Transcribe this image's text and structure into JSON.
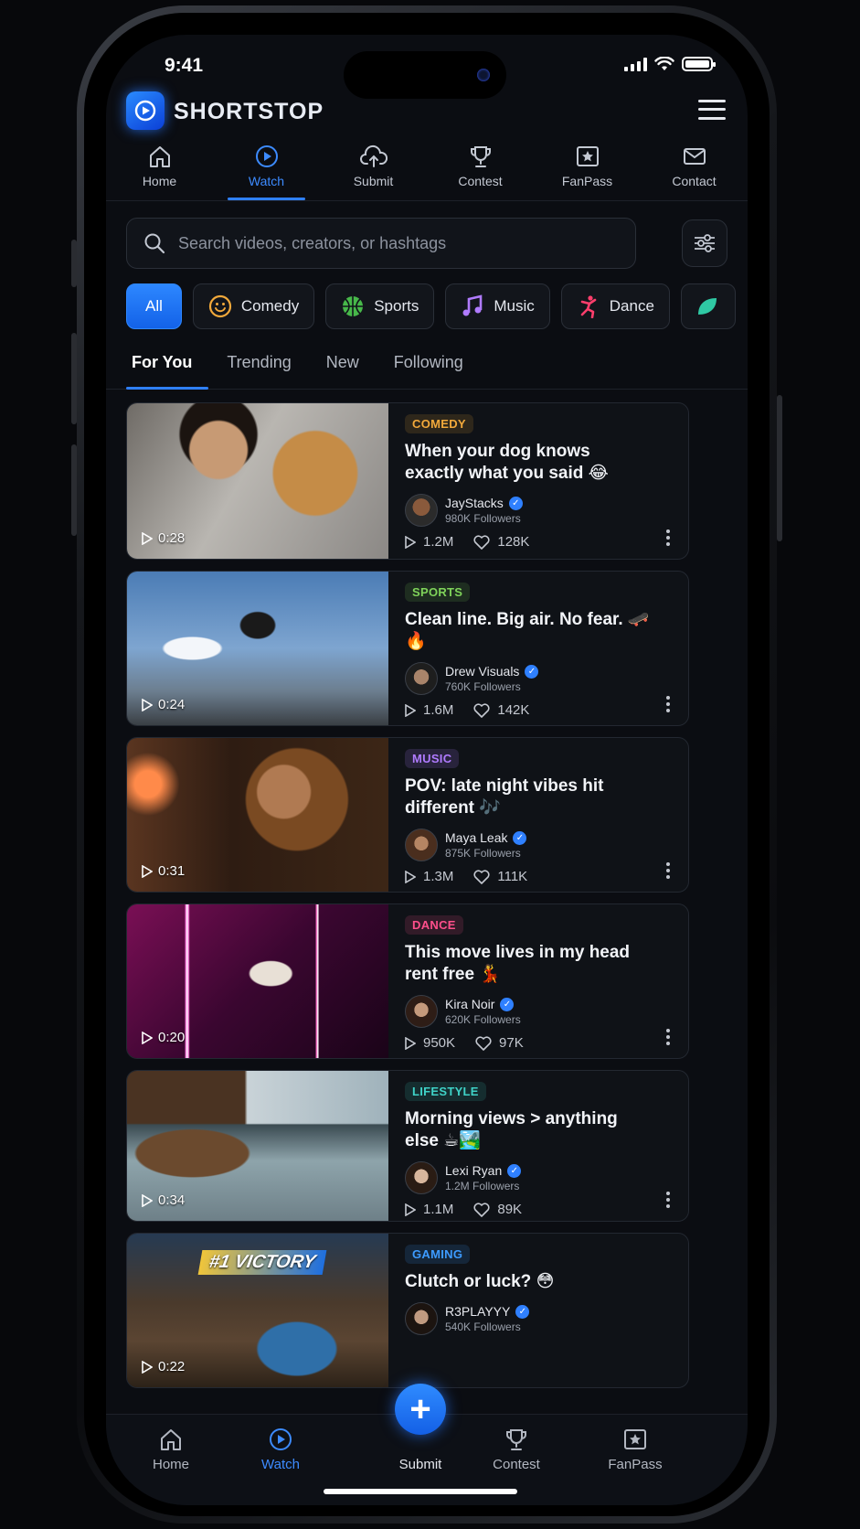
{
  "status": {
    "time": "9:41"
  },
  "app": {
    "name": "SHORTSTOP"
  },
  "top_nav": [
    {
      "label": "Home",
      "icon": "home-icon"
    },
    {
      "label": "Watch",
      "icon": "play-circle-icon",
      "active": true
    },
    {
      "label": "Submit",
      "icon": "cloud-upload-icon"
    },
    {
      "label": "Contest",
      "icon": "trophy-icon"
    },
    {
      "label": "FanPass",
      "icon": "star-ticket-icon"
    },
    {
      "label": "Contact",
      "icon": "mail-icon"
    }
  ],
  "search": {
    "placeholder": "Search videos, creators, or hashtags"
  },
  "chips": [
    {
      "label": "All",
      "active": true
    },
    {
      "label": "Comedy",
      "emoji": "🙂"
    },
    {
      "label": "Sports",
      "emoji": "🏀"
    },
    {
      "label": "Music",
      "emoji": "🎵"
    },
    {
      "label": "Dance",
      "emoji": "🕺"
    }
  ],
  "feed_tabs": [
    "For You",
    "Trending",
    "New",
    "Following"
  ],
  "videos": [
    {
      "category": "COMEDY",
      "cat_color": "#f2a93b",
      "title": "When your dog knows exactly what you said 😂",
      "creator": "JayStacks",
      "followers": "980K Followers",
      "views": "1.2M",
      "likes": "128K",
      "duration": "0:28"
    },
    {
      "category": "SPORTS",
      "cat_color": "#7fd35a",
      "title": "Clean line. Big air. No fear. 🛹🔥",
      "creator": "Drew Visuals",
      "followers": "760K Followers",
      "views": "1.6M",
      "likes": "142K",
      "duration": "0:24"
    },
    {
      "category": "MUSIC",
      "cat_color": "#b07bff",
      "title": "POV: late night vibes hit different 🎶",
      "creator": "Maya Leak",
      "followers": "875K Followers",
      "views": "1.3M",
      "likes": "111K",
      "duration": "0:31"
    },
    {
      "category": "DANCE",
      "cat_color": "#ff4f8b",
      "title": "This move lives in my head rent free 💃",
      "creator": "Kira Noir",
      "followers": "620K Followers",
      "views": "950K",
      "likes": "97K",
      "duration": "0:20"
    },
    {
      "category": "LIFESTYLE",
      "cat_color": "#3fd2c7",
      "title": "Morning views > anything else ☕🏞️",
      "creator": "Lexi Ryan",
      "followers": "1.2M Followers",
      "views": "1.1M",
      "likes": "89K",
      "duration": "0:34"
    },
    {
      "category": "GAMING",
      "cat_color": "#3d9bff",
      "title": "Clutch or luck? 😳",
      "creator": "R3PLAYYY",
      "followers": "540K Followers",
      "views": "",
      "likes": "",
      "duration": "0:22",
      "thumb_text": "#1 VICTORY"
    }
  ],
  "bottom_nav": [
    {
      "label": "Home"
    },
    {
      "label": "Watch",
      "active": true
    },
    {
      "label": "Submit"
    },
    {
      "label": "Contest"
    },
    {
      "label": "FanPass"
    }
  ]
}
